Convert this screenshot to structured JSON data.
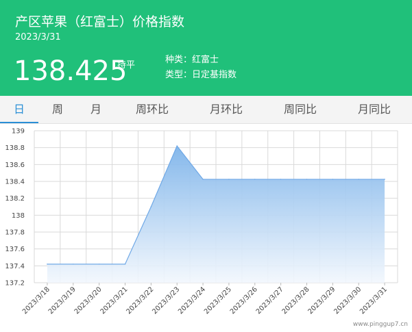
{
  "header": {
    "title": "产区苹果（红富士）价格指数",
    "date": "2023/3/31",
    "price": "138.425",
    "trend": "持平",
    "variety": "种类：红富士",
    "index_type": "类型：日定基指数"
  },
  "tabs": [
    {
      "label": "日"
    },
    {
      "label": "周"
    },
    {
      "label": "月"
    },
    {
      "label": "周环比"
    },
    {
      "label": "月环比"
    },
    {
      "label": "周同比"
    },
    {
      "label": "月同比"
    }
  ],
  "colors": {
    "header_bg": "#20c07a",
    "tab_active": "#2a8fd6",
    "line": "#6fa8e6",
    "fill_top": "#7eb4ea",
    "fill_bottom": "#f2f7fd"
  },
  "watermark": "www.pinggup7.cn",
  "chart_data": {
    "type": "area",
    "title": "",
    "xlabel": "",
    "ylabel": "",
    "categories": [
      "2023/3/18",
      "2023/3/19",
      "2023/3/20",
      "2023/3/21",
      "2023/3/22",
      "2023/3/23",
      "2023/3/24",
      "2023/3/25",
      "2023/3/26",
      "2023/3/27",
      "2023/3/28",
      "2023/3/29",
      "2023/3/30",
      "2023/3/31"
    ],
    "values": [
      137.42,
      137.42,
      137.42,
      137.42,
      138.1,
      138.82,
      138.425,
      138.425,
      138.425,
      138.425,
      138.425,
      138.425,
      138.425,
      138.425
    ],
    "ylim": [
      137.2,
      139
    ],
    "yticks": [
      "137.2",
      "137.4",
      "137.6",
      "137.8",
      "138",
      "138.2",
      "138.4",
      "138.6",
      "138.8",
      "139"
    ],
    "grid": true,
    "legend": "none"
  }
}
